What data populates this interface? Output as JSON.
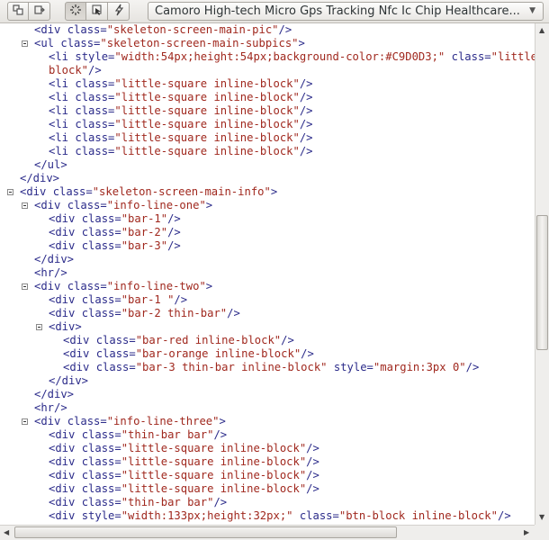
{
  "toolbar": {
    "buttons_left": [
      "frame-icon",
      "next-frame-icon"
    ],
    "buttons_tools": [
      "select-element-icon",
      "pick-element-icon",
      "flash-icon"
    ],
    "selector": {
      "value": "Camoro High-tech Micro Gps Tracking Nfc Ic Chip Healthcare..."
    }
  },
  "code_lines": [
    [
      {
        "t": "<div ",
        "c": "tag"
      },
      {
        "t": "class=",
        "c": "attr"
      },
      {
        "t": "\"skeleton-screen-main-pic\"",
        "c": "val"
      },
      {
        "t": "/>",
        "c": "tag"
      }
    ],
    [
      {
        "t": "<ul ",
        "c": "tag"
      },
      {
        "t": "class=",
        "c": "attr"
      },
      {
        "t": "\"skeleton-screen-main-subpics\"",
        "c": "val"
      },
      {
        "t": ">",
        "c": "tag"
      }
    ],
    [
      {
        "t": "<li ",
        "c": "tag"
      },
      {
        "t": "style=",
        "c": "attr"
      },
      {
        "t": "\"width:54px;height:54px;background-color:#C9D0D3;\"",
        "c": "val"
      },
      {
        "t": " class=",
        "c": "attr"
      },
      {
        "t": "\"little-square inline-",
        "c": "val"
      }
    ],
    [
      {
        "t": "block\"",
        "c": "val"
      },
      {
        "t": "/>",
        "c": "tag"
      }
    ],
    [
      {
        "t": "<li ",
        "c": "tag"
      },
      {
        "t": "class=",
        "c": "attr"
      },
      {
        "t": "\"little-square inline-block\"",
        "c": "val"
      },
      {
        "t": "/>",
        "c": "tag"
      }
    ],
    [
      {
        "t": "<li ",
        "c": "tag"
      },
      {
        "t": "class=",
        "c": "attr"
      },
      {
        "t": "\"little-square inline-block\"",
        "c": "val"
      },
      {
        "t": "/>",
        "c": "tag"
      }
    ],
    [
      {
        "t": "<li ",
        "c": "tag"
      },
      {
        "t": "class=",
        "c": "attr"
      },
      {
        "t": "\"little-square inline-block\"",
        "c": "val"
      },
      {
        "t": "/>",
        "c": "tag"
      }
    ],
    [
      {
        "t": "<li ",
        "c": "tag"
      },
      {
        "t": "class=",
        "c": "attr"
      },
      {
        "t": "\"little-square inline-block\"",
        "c": "val"
      },
      {
        "t": "/>",
        "c": "tag"
      }
    ],
    [
      {
        "t": "<li ",
        "c": "tag"
      },
      {
        "t": "class=",
        "c": "attr"
      },
      {
        "t": "\"little-square inline-block\"",
        "c": "val"
      },
      {
        "t": "/>",
        "c": "tag"
      }
    ],
    [
      {
        "t": "<li ",
        "c": "tag"
      },
      {
        "t": "class=",
        "c": "attr"
      },
      {
        "t": "\"little-square inline-block\"",
        "c": "val"
      },
      {
        "t": "/>",
        "c": "tag"
      }
    ],
    [
      {
        "t": "</ul>",
        "c": "tag"
      }
    ],
    [
      {
        "t": "</div>",
        "c": "tag"
      }
    ],
    [
      {
        "t": "<div ",
        "c": "tag"
      },
      {
        "t": "class=",
        "c": "attr"
      },
      {
        "t": "\"skeleton-screen-main-info\"",
        "c": "val"
      },
      {
        "t": ">",
        "c": "tag"
      }
    ],
    [
      {
        "t": "<div ",
        "c": "tag"
      },
      {
        "t": "class=",
        "c": "attr"
      },
      {
        "t": "\"info-line-one\"",
        "c": "val"
      },
      {
        "t": ">",
        "c": "tag"
      }
    ],
    [
      {
        "t": "<div ",
        "c": "tag"
      },
      {
        "t": "class=",
        "c": "attr"
      },
      {
        "t": "\"bar-1\"",
        "c": "val"
      },
      {
        "t": "/>",
        "c": "tag"
      }
    ],
    [
      {
        "t": "<div ",
        "c": "tag"
      },
      {
        "t": "class=",
        "c": "attr"
      },
      {
        "t": "\"bar-2\"",
        "c": "val"
      },
      {
        "t": "/>",
        "c": "tag"
      }
    ],
    [
      {
        "t": "<div ",
        "c": "tag"
      },
      {
        "t": "class=",
        "c": "attr"
      },
      {
        "t": "\"bar-3\"",
        "c": "val"
      },
      {
        "t": "/>",
        "c": "tag"
      }
    ],
    [
      {
        "t": "</div>",
        "c": "tag"
      }
    ],
    [
      {
        "t": "<hr/>",
        "c": "tag"
      }
    ],
    [
      {
        "t": "<div ",
        "c": "tag"
      },
      {
        "t": "class=",
        "c": "attr"
      },
      {
        "t": "\"info-line-two\"",
        "c": "val"
      },
      {
        "t": ">",
        "c": "tag"
      }
    ],
    [
      {
        "t": "<div ",
        "c": "tag"
      },
      {
        "t": "class=",
        "c": "attr"
      },
      {
        "t": "\"bar-1 \"",
        "c": "val"
      },
      {
        "t": "/>",
        "c": "tag"
      }
    ],
    [
      {
        "t": "<div ",
        "c": "tag"
      },
      {
        "t": "class=",
        "c": "attr"
      },
      {
        "t": "\"bar-2 thin-bar\"",
        "c": "val"
      },
      {
        "t": "/>",
        "c": "tag"
      }
    ],
    [
      {
        "t": "<div>",
        "c": "tag"
      }
    ],
    [
      {
        "t": "<div ",
        "c": "tag"
      },
      {
        "t": "class=",
        "c": "attr"
      },
      {
        "t": "\"bar-red inline-block\"",
        "c": "val"
      },
      {
        "t": "/>",
        "c": "tag"
      }
    ],
    [
      {
        "t": "<div ",
        "c": "tag"
      },
      {
        "t": "class=",
        "c": "attr"
      },
      {
        "t": "\"bar-orange inline-block\"",
        "c": "val"
      },
      {
        "t": "/>",
        "c": "tag"
      }
    ],
    [
      {
        "t": "<div ",
        "c": "tag"
      },
      {
        "t": "class=",
        "c": "attr"
      },
      {
        "t": "\"bar-3 thin-bar inline-block\"",
        "c": "val"
      },
      {
        "t": " style=",
        "c": "attr"
      },
      {
        "t": "\"margin:3px 0\"",
        "c": "val"
      },
      {
        "t": "/>",
        "c": "tag"
      }
    ],
    [
      {
        "t": "</div>",
        "c": "tag"
      }
    ],
    [
      {
        "t": "</div>",
        "c": "tag"
      }
    ],
    [
      {
        "t": "<hr/>",
        "c": "tag"
      }
    ],
    [
      {
        "t": "<div ",
        "c": "tag"
      },
      {
        "t": "class=",
        "c": "attr"
      },
      {
        "t": "\"info-line-three\"",
        "c": "val"
      },
      {
        "t": ">",
        "c": "tag"
      }
    ],
    [
      {
        "t": "<div ",
        "c": "tag"
      },
      {
        "t": "class=",
        "c": "attr"
      },
      {
        "t": "\"thin-bar bar\"",
        "c": "val"
      },
      {
        "t": "/>",
        "c": "tag"
      }
    ],
    [
      {
        "t": "<div ",
        "c": "tag"
      },
      {
        "t": "class=",
        "c": "attr"
      },
      {
        "t": "\"little-square inline-block\"",
        "c": "val"
      },
      {
        "t": "/>",
        "c": "tag"
      }
    ],
    [
      {
        "t": "<div ",
        "c": "tag"
      },
      {
        "t": "class=",
        "c": "attr"
      },
      {
        "t": "\"little-square inline-block\"",
        "c": "val"
      },
      {
        "t": "/>",
        "c": "tag"
      }
    ],
    [
      {
        "t": "<div ",
        "c": "tag"
      },
      {
        "t": "class=",
        "c": "attr"
      },
      {
        "t": "\"little-square inline-block\"",
        "c": "val"
      },
      {
        "t": "/>",
        "c": "tag"
      }
    ],
    [
      {
        "t": "<div ",
        "c": "tag"
      },
      {
        "t": "class=",
        "c": "attr"
      },
      {
        "t": "\"little-square inline-block\"",
        "c": "val"
      },
      {
        "t": "/>",
        "c": "tag"
      }
    ],
    [
      {
        "t": "<div ",
        "c": "tag"
      },
      {
        "t": "class=",
        "c": "attr"
      },
      {
        "t": "\"thin-bar bar\"",
        "c": "val"
      },
      {
        "t": "/>",
        "c": "tag"
      }
    ],
    [
      {
        "t": "<div ",
        "c": "tag"
      },
      {
        "t": "style=",
        "c": "attr"
      },
      {
        "t": "\"width:133px;height:32px;\"",
        "c": "val"
      },
      {
        "t": " class=",
        "c": "attr"
      },
      {
        "t": "\"btn-block inline-block\"",
        "c": "val"
      },
      {
        "t": "/>",
        "c": "tag"
      }
    ]
  ],
  "colors": {
    "tag": "#2b2b8a",
    "value": "#a0281e",
    "background": "#ffffff"
  }
}
